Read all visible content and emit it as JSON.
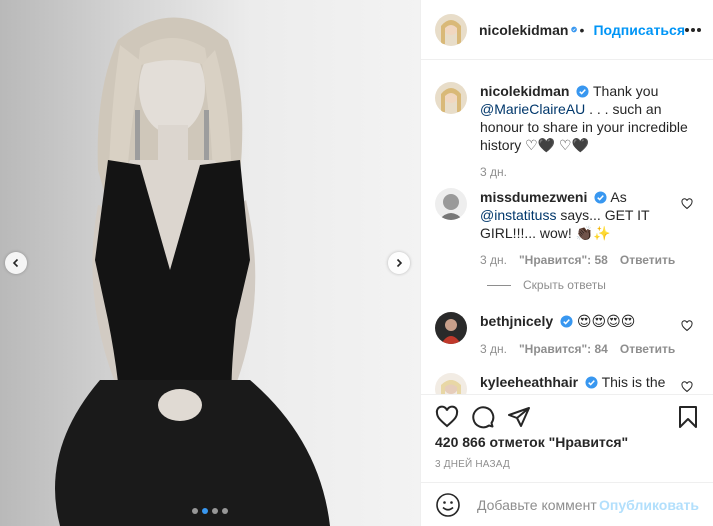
{
  "colors": {
    "accent": "#0095f6",
    "muted": "#8e8e8e",
    "text": "#262626",
    "link": "#00376b",
    "publish_disabled": "#b2dffc"
  },
  "header": {
    "username": "nicolekidman",
    "follow_label": "Подписаться",
    "more_icon": "more-options-icon"
  },
  "caption": {
    "username": "nicolekidman",
    "text_before": "Thank you",
    "mention": "@MarieClaireAU",
    "text_after": " . . . such an honour to share in your incredible history ♡🖤 ♡🖤",
    "time": "3 дн."
  },
  "comments": [
    {
      "username": "missdumezweni",
      "text_before": "As",
      "mention": "@instatituss",
      "text_after": " says... GET IT GIRL!!!... wow! 👏🏿✨",
      "time": "3 дн.",
      "likes": "\"Нравится\": 58",
      "reply": "Ответить"
    },
    {
      "username": "bethjnicely",
      "text_before": "😍😍😍😍",
      "mention": "",
      "text_after": "",
      "time": "3 дн.",
      "likes": "\"Нравится\": 84",
      "reply": "Ответить"
    },
    {
      "username": "kyleeheathhair",
      "text_before": "This is the",
      "mention": "",
      "text_after": "",
      "time": "",
      "likes": "",
      "reply": ""
    }
  ],
  "hide_replies": "Скрыть ответы",
  "likes_count": "420 866 отметок \"Нравится\"",
  "post_date": "3 ДНЕЙ НАЗАД",
  "add_comment": {
    "placeholder": "Добавьте комментарий...",
    "publish_label": "Опубликовать"
  },
  "carousel": {
    "total": 4,
    "current": 2
  }
}
